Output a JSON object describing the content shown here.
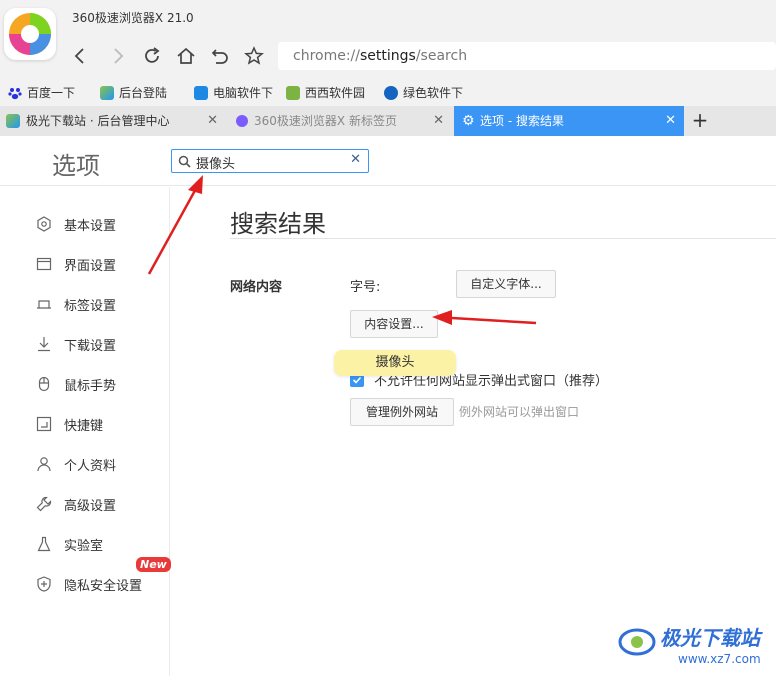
{
  "browser": {
    "title": "360极速浏览器X 21.0",
    "address": {
      "prefix": "chrome://",
      "host": "settings",
      "path": "/search"
    }
  },
  "bookmarks": [
    "百度一下",
    "后台登陆",
    "电脑软件下",
    "西西软件园",
    "绿色软件下"
  ],
  "tabs": [
    {
      "label": "极光下载站 · 后台管理中心"
    },
    {
      "label": "360极速浏览器X 新标签页"
    },
    {
      "label": "选项 - 搜索结果",
      "active": true
    }
  ],
  "settings": {
    "heading": "选项",
    "search_query": "摄像头",
    "sidebar": [
      {
        "label": "基本设置",
        "icon": "gear-icon"
      },
      {
        "label": "界面设置",
        "icon": "window-icon"
      },
      {
        "label": "标签设置",
        "icon": "tab-icon"
      },
      {
        "label": "下载设置",
        "icon": "download-icon"
      },
      {
        "label": "鼠标手势",
        "icon": "mouse-icon"
      },
      {
        "label": "快捷键",
        "icon": "shortcut-icon"
      },
      {
        "label": "个人资料",
        "icon": "person-icon"
      },
      {
        "label": "高级设置",
        "icon": "wrench-icon"
      },
      {
        "label": "实验室",
        "icon": "flask-icon"
      },
      {
        "label": "隐私安全设置",
        "icon": "shield-icon",
        "badge": "New"
      }
    ],
    "results": {
      "title": "搜索结果",
      "section": "网络内容",
      "font_label": "字号:",
      "custom_font_button": "自定义字体...",
      "content_settings_button": "内容设置...",
      "tooltip": "摄像头",
      "popup_checkbox_label": "不允许任何网站显示弹出式窗口（推荐）",
      "popup_checked": true,
      "manage_exceptions_button": "管理例外网站",
      "exceptions_hint": "例外网站可以弹出窗口"
    }
  },
  "watermark": {
    "name": "极光下载站",
    "url": "www.xz7.com"
  },
  "colors": {
    "accent": "#3a95f5",
    "annotation_arrow": "#e02020",
    "tooltip_bg": "#fbf2a6",
    "badge": "#e93a3a"
  }
}
